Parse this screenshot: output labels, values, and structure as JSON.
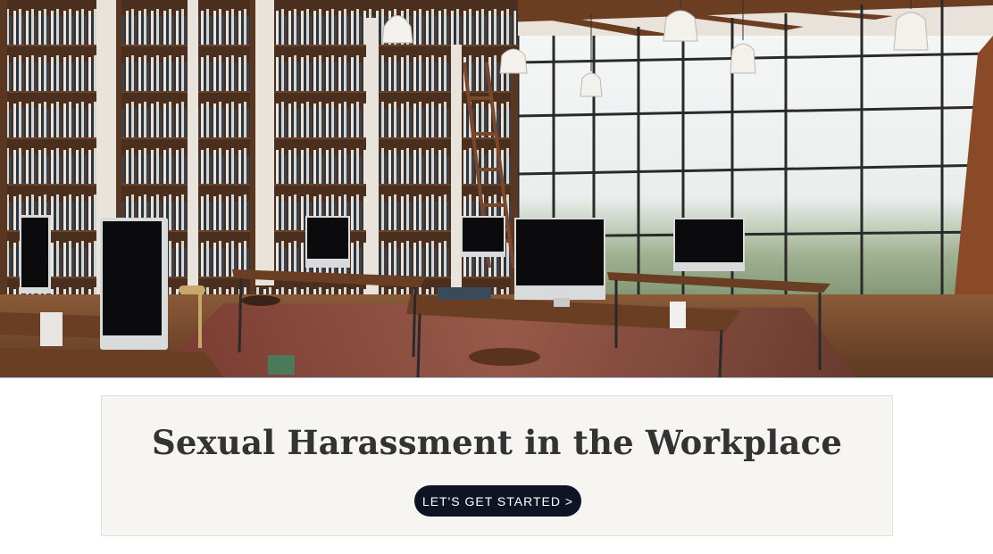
{
  "hero": {
    "image_subject": "library-office-interior-image"
  },
  "card": {
    "title": "Sexual Harassment in the Workplace",
    "cta_label": "LET'S GET STARTED >"
  },
  "colors": {
    "card_background": "#f6f5f2",
    "title_text": "#333333",
    "cta_background": "#0f1424",
    "cta_text": "#ffffff"
  }
}
